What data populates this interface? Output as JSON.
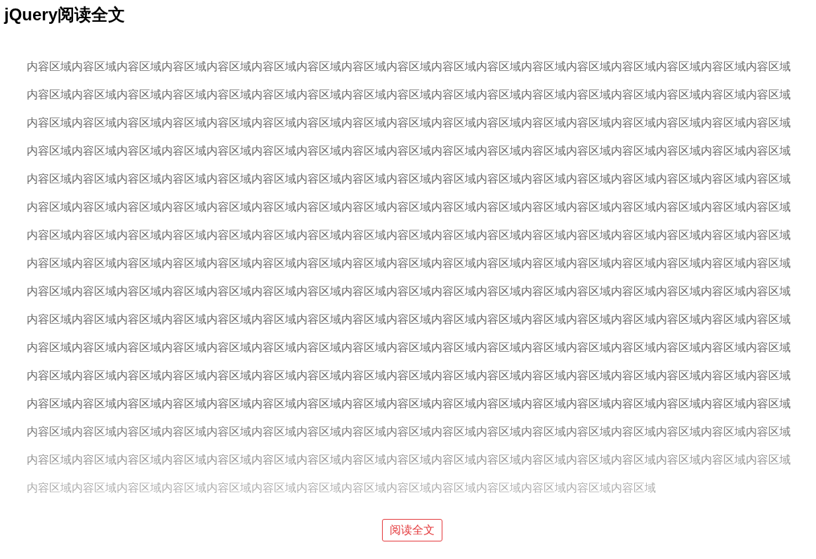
{
  "title": "jQuery阅读全文",
  "content": {
    "text": "内容区域内容区域内容区域内容区域内容区域内容区域内容区域内容区域内容区域内容区域内容区域内容区域内容区域内容区域内容区域内容区域内容区域内容区域内容区域内容区域内容区域内容区域内容区域内容区域内容区域内容区域内容区域内容区域内容区域内容区域内容区域内容区域内容区域内容区域内容区域内容区域内容区域内容区域内容区域内容区域内容区域内容区域内容区域内容区域内容区域内容区域内容区域内容区域内容区域内容区域内容区域内容区域内容区域内容区域内容区域内容区域内容区域内容区域内容区域内容区域内容区域内容区域内容区域内容区域内容区域内容区域内容区域内容区域内容区域内容区域内容区域内容区域内容区域内容区域内容区域内容区域内容区域内容区域内容区域内容区域内容区域内容区域内容区域内容区域内容区域内容区域内容区域内容区域内容区域内容区域内容区域内容区域内容区域内容区域内容区域内容区域内容区域内容区域内容区域内容区域内容区域内容区域内容区域内容区域内容区域内容区域内容区域内容区域内容区域内容区域内容区域内容区域内容区域内容区域内容区域内容区域内容区域内容区域内容区域内容区域内容区域内容区域内容区域内容区域内容区域内容区域内容区域内容区域内容区域内容区域内容区域内容区域内容区域内容区域内容区域内容区域内容区域内容区域内容区域内容区域内容区域内容区域内容区域内容区域内容区域内容区域内容区域内容区域内容区域内容区域内容区域内容区域内容区域内容区域内容区域内容区域内容区域内容区域内容区域内容区域内容区域内容区域内容区域内容区域内容区域内容区域内容区域内容区域内容区域内容区域内容区域内容区域内容区域内容区域内容区域内容区域内容区域内容区域内容区域内容区域内容区域内容区域内容区域内容区域内容区域内容区域内容区域内容区域内容区域内容区域内容区域内容区域内容区域内容区域内容区域内容区域内容区域内容区域内容区域内容区域内容区域内容区域内容区域内容区域内容区域内容区域内容区域内容区域内容区域内容区域内容区域内容区域内容区域内容区域内容区域内容区域内容区域内容区域内容区域内容区域内容区域内容区域内容区域内容区域内容区域内容区域内容区域内容区域内容区域内容区域内容区域内容区域内容区域内容区域内容区域内容区域内容区域内容区域内容区域内容区域内容区域内容区域内容区域内容区域内容区域内容区域内容区域内容区域内容区域内容区域内容区域内容区域内容区域内容区域内容区域内容区域内容区域内容区域内容区域内容区域内容区域内容区域内容区域内容区域内容区域内容区域内容区域内容区域内容区域",
    "expanded": false
  },
  "button": {
    "label": "阅读全文"
  }
}
